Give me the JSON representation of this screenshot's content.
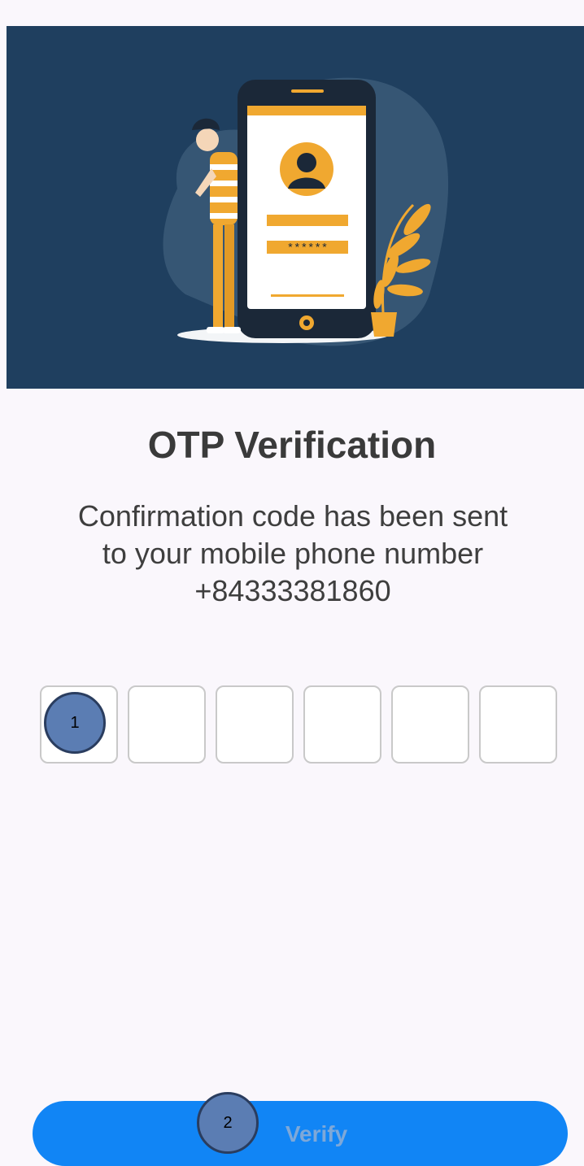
{
  "screen": {
    "title": "OTP Verification",
    "message_line1": "Confirmation code has been sent",
    "message_line2": "to your mobile phone number",
    "phone_number": "+84333381860"
  },
  "otp": {
    "digits": [
      "",
      "",
      "",
      "",
      "",
      ""
    ]
  },
  "illustration": {
    "masked_password": "******"
  },
  "annotations": {
    "marker1": "1",
    "marker2": "2"
  },
  "actions": {
    "verify_label": "Verify"
  },
  "colors": {
    "hero_background": "#1f3f5f",
    "accent": "#f0a830",
    "button": "#1185f5"
  }
}
